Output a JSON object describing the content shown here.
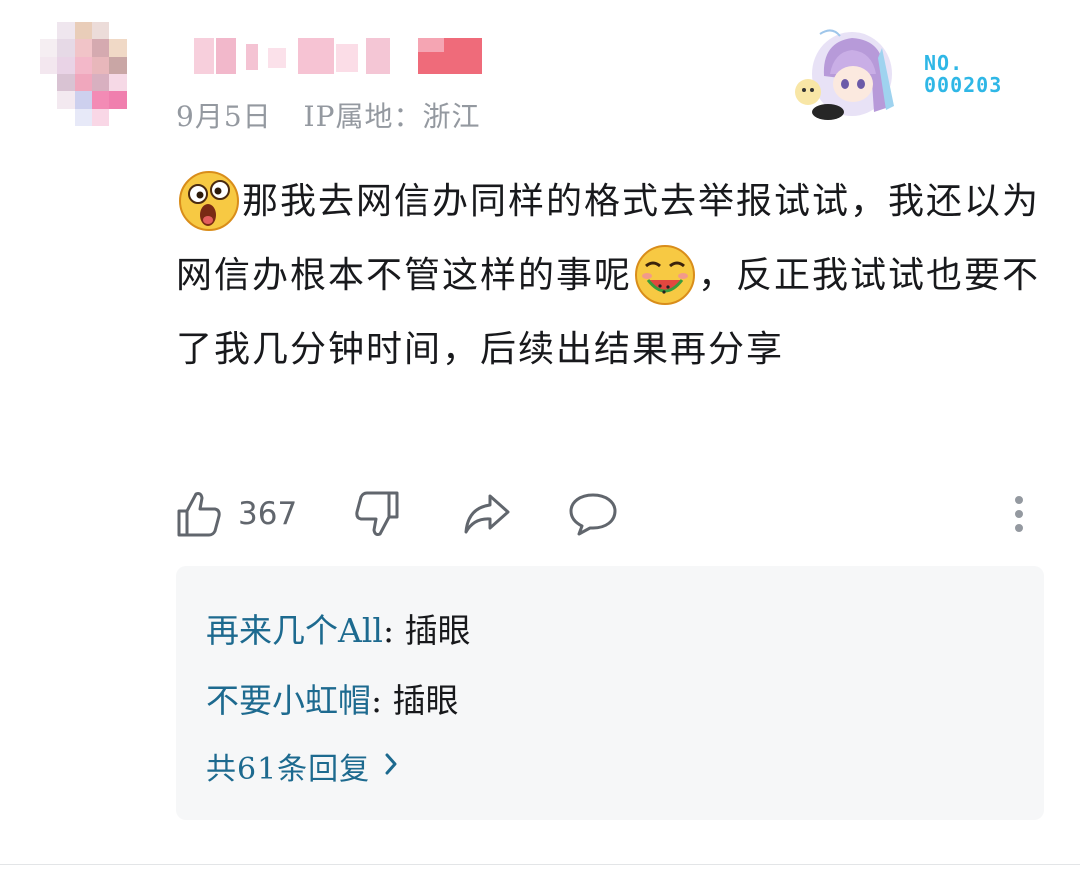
{
  "comment": {
    "date": "9月5日",
    "ip_location": "IP属地：浙江",
    "fan_badge": {
      "prefix": "NO.",
      "number": "000203",
      "accent_color": "#2fb7e6"
    },
    "text": {
      "part1": "那我去网信办同样的格式去举报试试，我还以为网信办根本不管这样的事呢",
      "part2": "，反正我试试也要不了我几分钟时间，后续出结果再分享"
    },
    "emojis": [
      "shocked-face-emoji",
      "watermelon-face-emoji"
    ]
  },
  "actions": {
    "like_count": "367",
    "icons": [
      "thumbs-up-icon",
      "thumbs-down-icon",
      "share-icon",
      "reply-icon",
      "more-icon"
    ]
  },
  "replies": {
    "items": [
      {
        "user": "再来几个All",
        "separator": ":",
        "text": "插眼"
      },
      {
        "user": "不要小虹帽",
        "separator": ":",
        "text": "插眼"
      }
    ],
    "more_label": "共61条回复",
    "link_color": "#1d6a8f"
  }
}
